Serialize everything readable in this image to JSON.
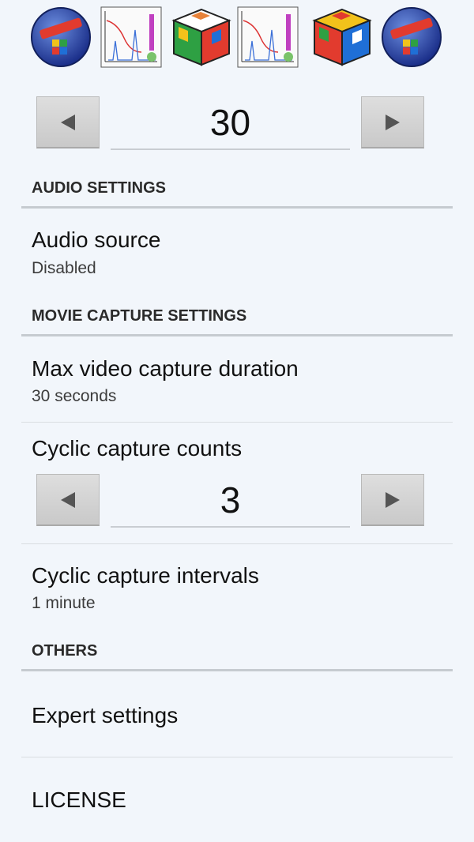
{
  "top_stepper": {
    "value": "30"
  },
  "audio_section": {
    "header": "AUDIO SETTINGS",
    "audio_source": {
      "title": "Audio source",
      "summary": "Disabled"
    }
  },
  "movie_section": {
    "header": "MOVIE CAPTURE SETTINGS",
    "max_duration": {
      "title": "Max video capture duration",
      "summary": "30 seconds"
    },
    "cyclic_counts": {
      "title": "Cyclic capture counts",
      "value": "3"
    },
    "cyclic_intervals": {
      "title": "Cyclic capture intervals",
      "summary": "1 minute"
    }
  },
  "others_section": {
    "header": "OTHERS",
    "expert": {
      "title": "Expert settings"
    },
    "license": {
      "title": "LICENSE"
    }
  },
  "colors": {
    "background": "#f2f6fb",
    "divider": "#c6cbd0",
    "button": "#d4d4d4"
  },
  "icons": [
    "innercube-logo-icon",
    "titration-chart-icon",
    "rubiks-cube-icon",
    "titration-chart-icon",
    "rubiks-cube-icon",
    "innercube-logo-icon"
  ]
}
